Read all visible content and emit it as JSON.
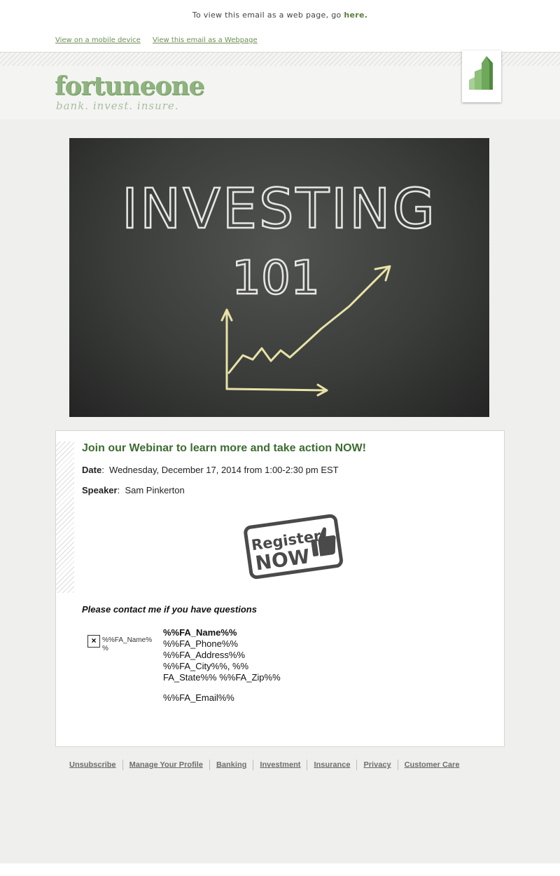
{
  "preheader": {
    "text": "To view this email as a web page, go",
    "link": "here."
  },
  "top_links": [
    "View on a mobile device",
    "View this email as a Webpage"
  ],
  "brand": {
    "name": "fortuneone",
    "tagline": "bank. invest. insure.",
    "color": "#8fb37e"
  },
  "hero": {
    "line1": "INVESTING",
    "line2": "101"
  },
  "webinar": {
    "headline": "Join our Webinar to learn more and take action NOW!",
    "date_label": "Date",
    "date_value": "Wednesday, December 17, 2014 from 1:00-2:30 pm EST",
    "speaker_label": "Speaker",
    "speaker_value": "Sam Pinkerton",
    "register_line1": "Register",
    "register_line2": "NOW"
  },
  "contact": {
    "title": "Please contact me if you have questions",
    "image_alt": "%%FA_Name%%",
    "name": "%%FA_Name%%",
    "phone": "%%FA_Phone%%",
    "address": "%%FA_Address%%",
    "city": "%%FA_City%%, %%",
    "state_zip": "FA_State%% %%FA_Zip%%",
    "email": "%%FA_Email%%"
  },
  "footer_links": [
    "Unsubscribe",
    "Manage Your Profile",
    "Banking",
    "Investment",
    "Insurance",
    "Privacy",
    "Customer Care"
  ]
}
